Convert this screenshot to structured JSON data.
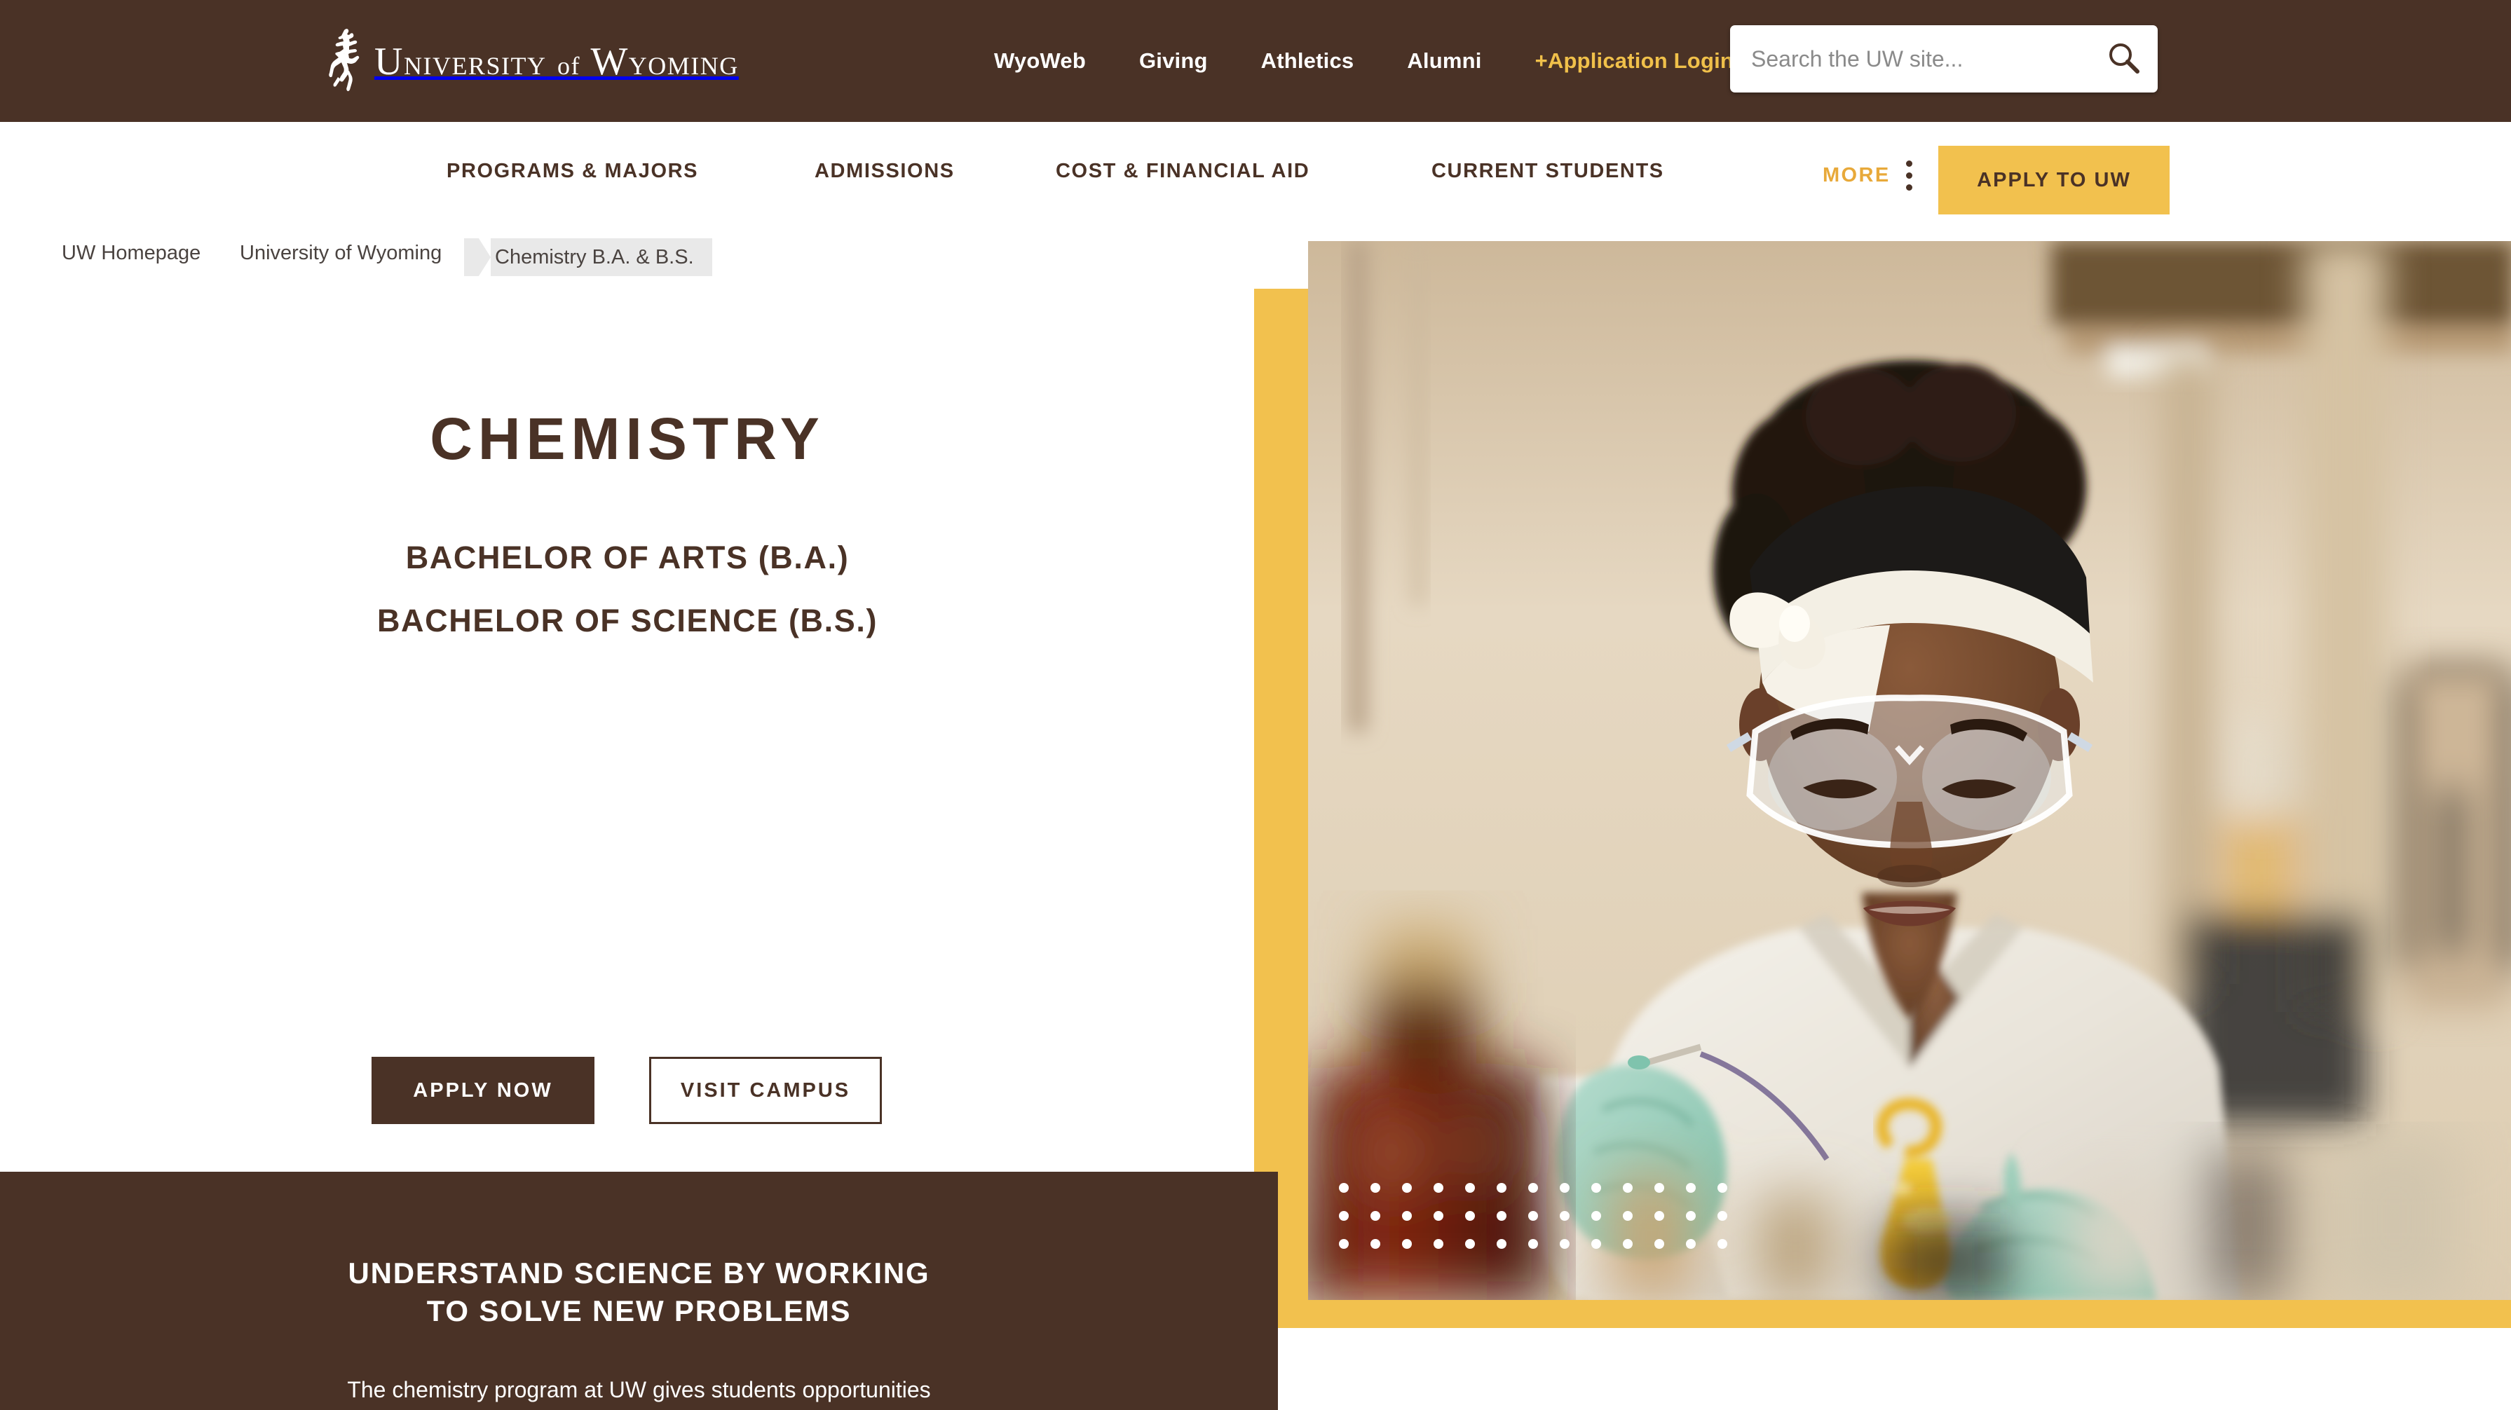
{
  "colors": {
    "brand_brown": "#4a3226",
    "brand_gold": "#f2c14e",
    "accent_gold_text": "#e8a93a",
    "breadcrumb_tag_bg": "#e9e9e9",
    "white": "#ffffff"
  },
  "header": {
    "logo_text_main": "NIVERSITY",
    "logo_text_u": "U",
    "logo_text_of": "of",
    "logo_text_w": "W",
    "logo_text_yoming": "YOMING",
    "logo_full": "University of Wyoming",
    "utility_nav": [
      {
        "label": "WyoWeb",
        "style": "white"
      },
      {
        "label": "Giving",
        "style": "white"
      },
      {
        "label": "Athletics",
        "style": "white"
      },
      {
        "label": "Alumni",
        "style": "white"
      },
      {
        "label": "+Application Login",
        "style": "gold"
      }
    ],
    "search": {
      "placeholder": "Search the UW site...",
      "value": "",
      "icon": "search-icon"
    }
  },
  "main_nav": {
    "items": [
      {
        "label": "PROGRAMS & MAJORS"
      },
      {
        "label": "ADMISSIONS"
      },
      {
        "label": "COST & FINANCIAL AID"
      },
      {
        "label": "CURRENT STUDENTS"
      }
    ],
    "more_label": "MORE",
    "more_icon": "kebab-menu-icon",
    "apply_button": "APPLY TO UW"
  },
  "breadcrumb": {
    "items": [
      {
        "label": "UW Homepage"
      },
      {
        "label": "University of Wyoming"
      }
    ],
    "current": "Chemistry B.A. & B.S."
  },
  "hero": {
    "title": "CHEMISTRY",
    "degrees": [
      "BACHELOR OF ARTS (B.A.)",
      "BACHELOR OF SCIENCE (B.S.)"
    ],
    "buttons": {
      "primary": "APPLY NOW",
      "secondary": "VISIT CAMPUS"
    },
    "image_alt": "Student in lab coat, safety goggles and teal gloves pouring yellow liquid into a flask in a chemistry laboratory",
    "dot_overlay": {
      "columns": 13,
      "rows": 3
    }
  },
  "bottom_section": {
    "heading_line1": "UNDERSTAND SCIENCE BY WORKING",
    "heading_line2": "TO SOLVE NEW PROBLEMS",
    "body": "The chemistry program at UW gives students opportunities"
  }
}
